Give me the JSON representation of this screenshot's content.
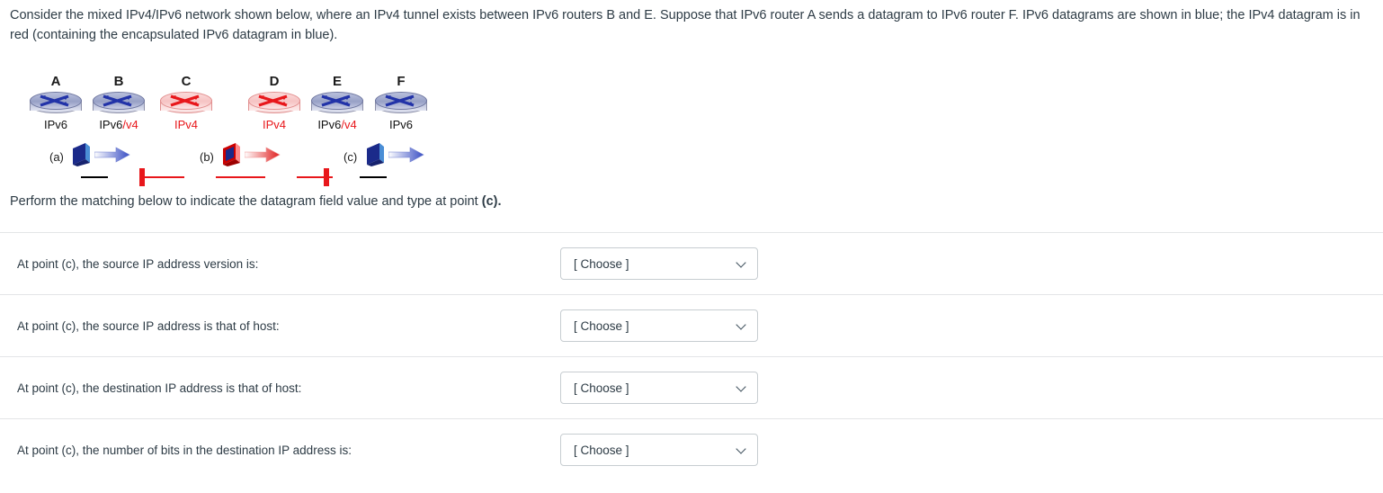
{
  "intro": {
    "text": "Consider the mixed IPv4/IPv6 network shown below, where an IPv4 tunnel exists between IPv6 routers B and E. Suppose that IPv6 router A sends a datagram to IPv6 router F.  IPv6 datagrams are shown in blue; the IPv4 datagram is in red (containing the encapsulated IPv6 datagram in blue)."
  },
  "diagram": {
    "routers": [
      {
        "name": "A",
        "proto_main": "IPv6",
        "proto_suffix": "",
        "type": "ipv6"
      },
      {
        "name": "B",
        "proto_main": "IPv6",
        "proto_suffix": "/v4",
        "type": "ipv6"
      },
      {
        "name": "C",
        "proto_main": "IPv4",
        "proto_suffix": "",
        "type": "ipv4"
      },
      {
        "name": "D",
        "proto_main": "IPv4",
        "proto_suffix": "",
        "type": "ipv4"
      },
      {
        "name": "E",
        "proto_main": "IPv6",
        "proto_suffix": "/v4",
        "type": "ipv6"
      },
      {
        "name": "F",
        "proto_main": "IPv6",
        "proto_suffix": "",
        "type": "ipv6"
      }
    ],
    "datagram_points": [
      {
        "tag": "(a)",
        "kind": "ipv6"
      },
      {
        "tag": "(b)",
        "kind": "ipv4-encapsulating-ipv6"
      },
      {
        "tag": "(c)",
        "kind": "ipv6"
      }
    ],
    "colors": {
      "ipv6_blue": "#2233a8",
      "ipv4_red": "#e8171b",
      "link_black": "#000000"
    }
  },
  "prompt": {
    "lead": "Perform the matching below to indicate the datagram field value and type at point ",
    "emphasis": "(c)."
  },
  "matching": {
    "placeholder": "[ Choose ]",
    "rows": [
      {
        "label": "At point (c), the source IP address version is:",
        "value": "[ Choose ]"
      },
      {
        "label": "At point (c), the source IP address is that of host:",
        "value": "[ Choose ]"
      },
      {
        "label": "At point (c), the destination IP address is that of host:",
        "value": "[ Choose ]"
      },
      {
        "label": "At point (c), the number of bits in the destination IP address is:",
        "value": "[ Choose ]"
      }
    ]
  }
}
